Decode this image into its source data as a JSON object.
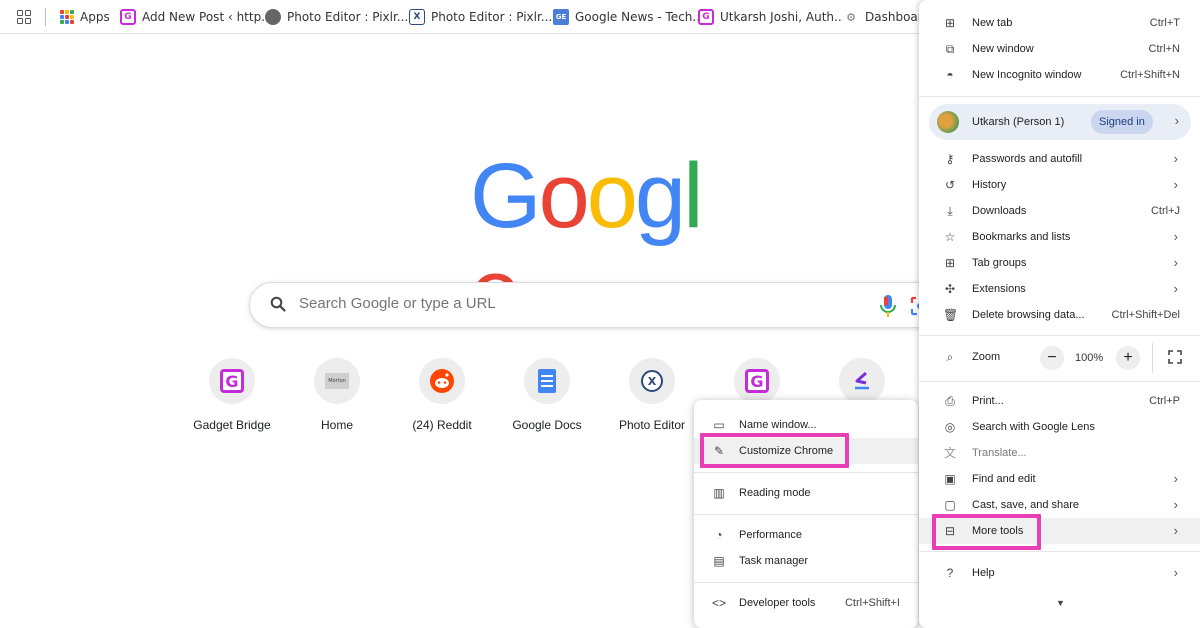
{
  "bookmarks": {
    "items": [
      {
        "label": "Apps",
        "icon": "apps-grid-icon"
      },
      {
        "label": "Add New Post ‹ http...",
        "icon": "gadget-bridge-icon"
      },
      {
        "label": "Photo Editor : Pixlr...",
        "icon": "globe-icon"
      },
      {
        "label": "Photo Editor : Pixlr...",
        "icon": "pixlr-icon"
      },
      {
        "label": "Google News - Tech...",
        "icon": "google-news-icon"
      },
      {
        "label": "Utkarsh Joshi, Auth...",
        "icon": "gadget-bridge-icon"
      },
      {
        "label": "Dashboard",
        "icon": "dashboard-icon"
      }
    ]
  },
  "newtab": {
    "logo_letters": [
      "G",
      "o",
      "o",
      "g",
      "l",
      "e"
    ],
    "search_placeholder": "Search Google or type a URL",
    "shortcuts": [
      {
        "label": "Gadget Bridge",
        "icon": "gadget-bridge-icon",
        "glyph": "G"
      },
      {
        "label": "Home",
        "icon": "home-site-icon",
        "glyph": "Morton"
      },
      {
        "label": "(24) Reddit",
        "icon": "reddit-icon",
        "glyph": ""
      },
      {
        "label": "Google Docs",
        "icon": "google-docs-icon",
        "glyph": ""
      },
      {
        "label": "Photo Editor",
        "icon": "pixlr-icon",
        "glyph": "X"
      },
      {
        "label": "",
        "icon": "gadget-bridge-icon",
        "glyph": "G"
      },
      {
        "label": "",
        "icon": "purple-arrow-icon",
        "glyph": ""
      }
    ]
  },
  "chrome_menu": {
    "new_tab": {
      "label": "New tab",
      "shortcut": "Ctrl+T"
    },
    "new_window": {
      "label": "New window",
      "shortcut": "Ctrl+N"
    },
    "new_incognito": {
      "label": "New Incognito window",
      "shortcut": "Ctrl+Shift+N"
    },
    "profile": {
      "name": "Utkarsh (Person 1)",
      "status": "Signed in"
    },
    "passwords": {
      "label": "Passwords and autofill"
    },
    "history": {
      "label": "History"
    },
    "downloads": {
      "label": "Downloads",
      "shortcut": "Ctrl+J"
    },
    "bookmarks": {
      "label": "Bookmarks and lists"
    },
    "tab_groups": {
      "label": "Tab groups"
    },
    "extensions": {
      "label": "Extensions"
    },
    "delete_data": {
      "label": "Delete browsing data...",
      "shortcut": "Ctrl+Shift+Del"
    },
    "zoom": {
      "label": "Zoom",
      "value": "100%",
      "minus": "−",
      "plus": "+"
    },
    "print": {
      "label": "Print...",
      "shortcut": "Ctrl+P"
    },
    "lens": {
      "label": "Search with Google Lens"
    },
    "translate": {
      "label": "Translate..."
    },
    "find_edit": {
      "label": "Find and edit"
    },
    "cast_save": {
      "label": "Cast, save, and share"
    },
    "more_tools": {
      "label": "More tools"
    },
    "help": {
      "label": "Help"
    }
  },
  "more_tools_submenu": {
    "name_window": {
      "label": "Name window..."
    },
    "customize_chrome": {
      "label": "Customize Chrome"
    },
    "reading_mode": {
      "label": "Reading mode"
    },
    "performance": {
      "label": "Performance"
    },
    "task_manager": {
      "label": "Task manager"
    },
    "developer_tools": {
      "label": "Developer tools",
      "shortcut": "Ctrl+Shift+I"
    }
  },
  "colors": {
    "highlight": "#e83fb6",
    "google_blue": "#4285f4",
    "google_red": "#ea4335",
    "google_yellow": "#fbbc05",
    "google_green": "#34a853"
  }
}
